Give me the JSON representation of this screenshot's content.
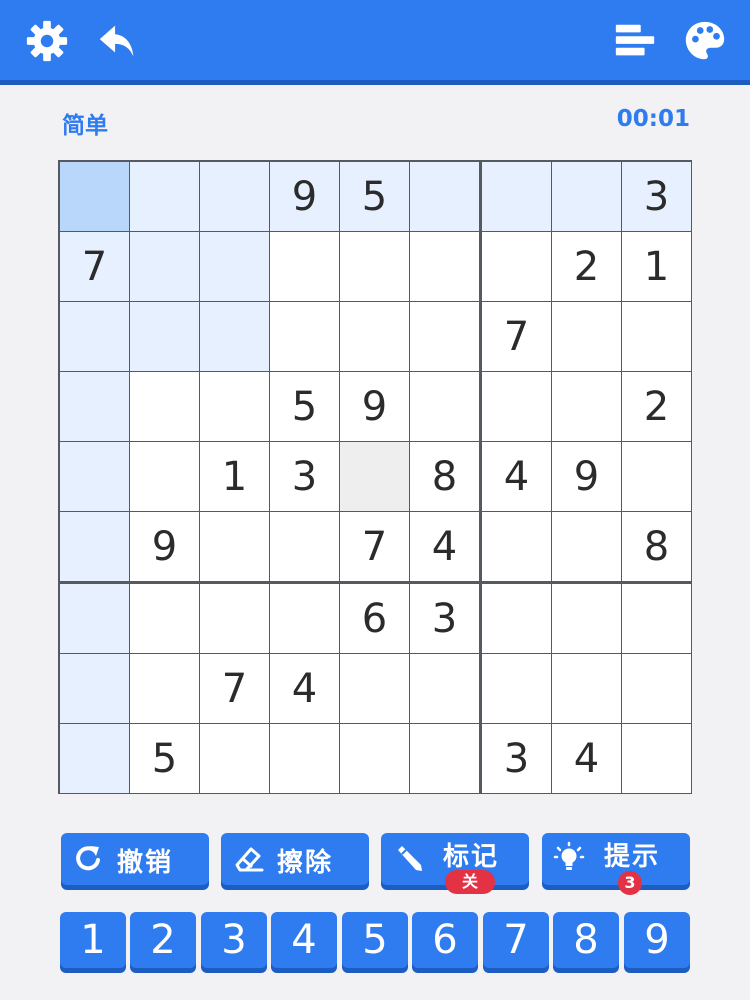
{
  "header": {
    "icons": [
      "settings-gear-icon",
      "undo-arrow-icon",
      "statistics-bars-icon",
      "theme-palette-icon"
    ],
    "bar_color": "#2f7bf0"
  },
  "status": {
    "difficulty": "简单",
    "timer": "00:01"
  },
  "board": {
    "rows": [
      [
        "",
        "",
        "",
        "9",
        "5",
        "",
        "",
        "",
        "3"
      ],
      [
        "7",
        "",
        "",
        "",
        "",
        "",
        "",
        "2",
        "1"
      ],
      [
        "",
        "",
        "",
        "",
        "",
        "",
        "7",
        "",
        ""
      ],
      [
        "",
        "",
        "",
        "5",
        "9",
        "",
        "",
        "",
        "2"
      ],
      [
        "",
        "",
        "1",
        "3",
        "",
        "8",
        "4",
        "9",
        ""
      ],
      [
        "",
        "9",
        "",
        "",
        "7",
        "4",
        "",
        "",
        "8"
      ],
      [
        "",
        "",
        "",
        "",
        "6",
        "3",
        "",
        "",
        ""
      ],
      [
        "",
        "",
        "7",
        "4",
        "",
        "",
        "",
        "",
        ""
      ],
      [
        "",
        "5",
        "",
        "",
        "",
        "",
        "3",
        "4",
        ""
      ]
    ],
    "selected_cell": [
      0,
      0
    ],
    "colors": {
      "selected": "#b9d6fb",
      "highlight": "#e6f0ff",
      "normal": "#ffffff",
      "grid": "#555a61"
    }
  },
  "actions": {
    "undo": {
      "label": "撤销",
      "icon": "undo-circular-arrow-icon"
    },
    "erase": {
      "label": "擦除",
      "icon": "eraser-icon"
    },
    "notes": {
      "label": "标记",
      "badge": "关",
      "icon": "pencil-icon"
    },
    "hint": {
      "label": "提示",
      "badge": "3",
      "icon": "lightbulb-icon"
    }
  },
  "numpad": [
    "1",
    "2",
    "3",
    "4",
    "5",
    "6",
    "7",
    "8",
    "9"
  ]
}
